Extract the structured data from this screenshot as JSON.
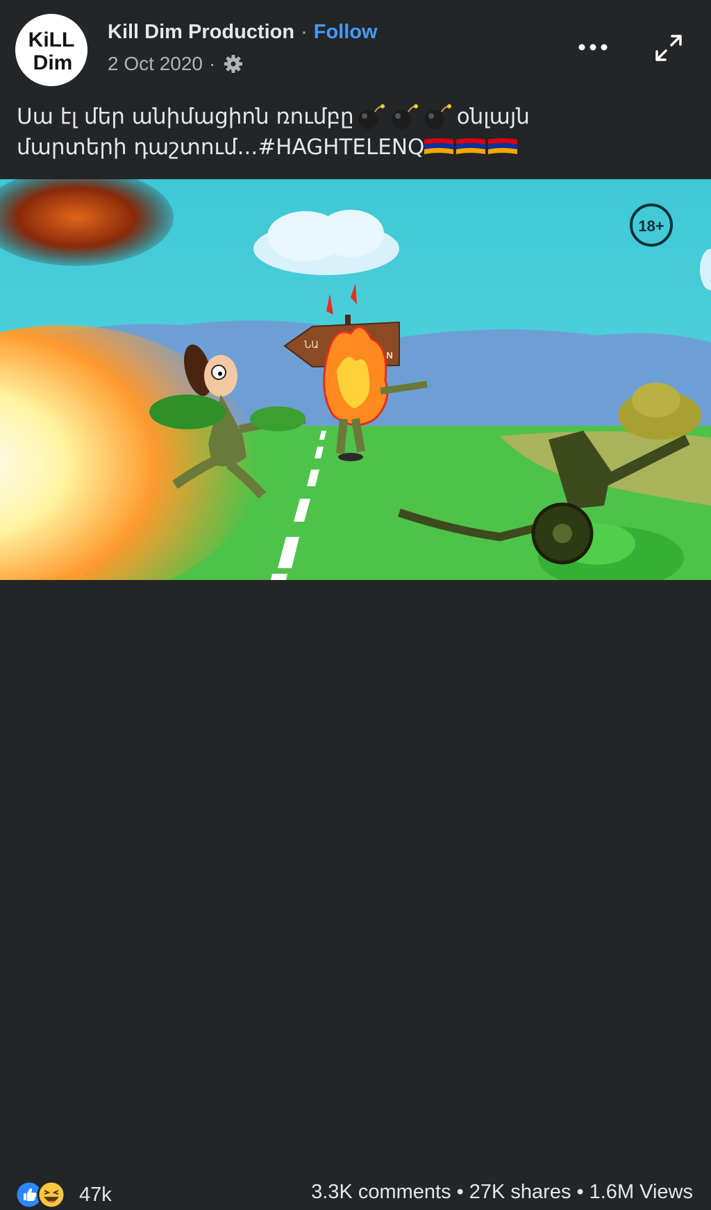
{
  "post": {
    "author": "Kill Dim Production",
    "separator": "·",
    "follow_label": "Follow",
    "date": "2 Oct 2020",
    "avatar_text_line1": "KiLL",
    "avatar_text_line2": "Dim",
    "caption_line1_text": "Սա էլ մեր անիմացիոն ռումբը",
    "caption_line1_tail": "օնլայն",
    "caption_line2_text": "մարտերի դաշտում...#HAGHTELENQ",
    "emoji": {
      "bomb": "bomb-emoji",
      "flag": "armenia-flag-emoji"
    }
  },
  "video": {
    "rating_badge": "18+",
    "sign_text_left": "ՆԱ",
    "sign_text_right": "TAN"
  },
  "footer": {
    "reactions_count": "47k",
    "reaction_icons": [
      "like-icon",
      "haha-icon"
    ],
    "comments": "3.3K comments",
    "shares": "27K shares",
    "views": "1.6M Views",
    "separator": "•"
  },
  "colors": {
    "background": "#242526",
    "text": "#e4e6eb",
    "secondary_text": "#b0b3b8",
    "follow_blue": "#4599ff"
  }
}
